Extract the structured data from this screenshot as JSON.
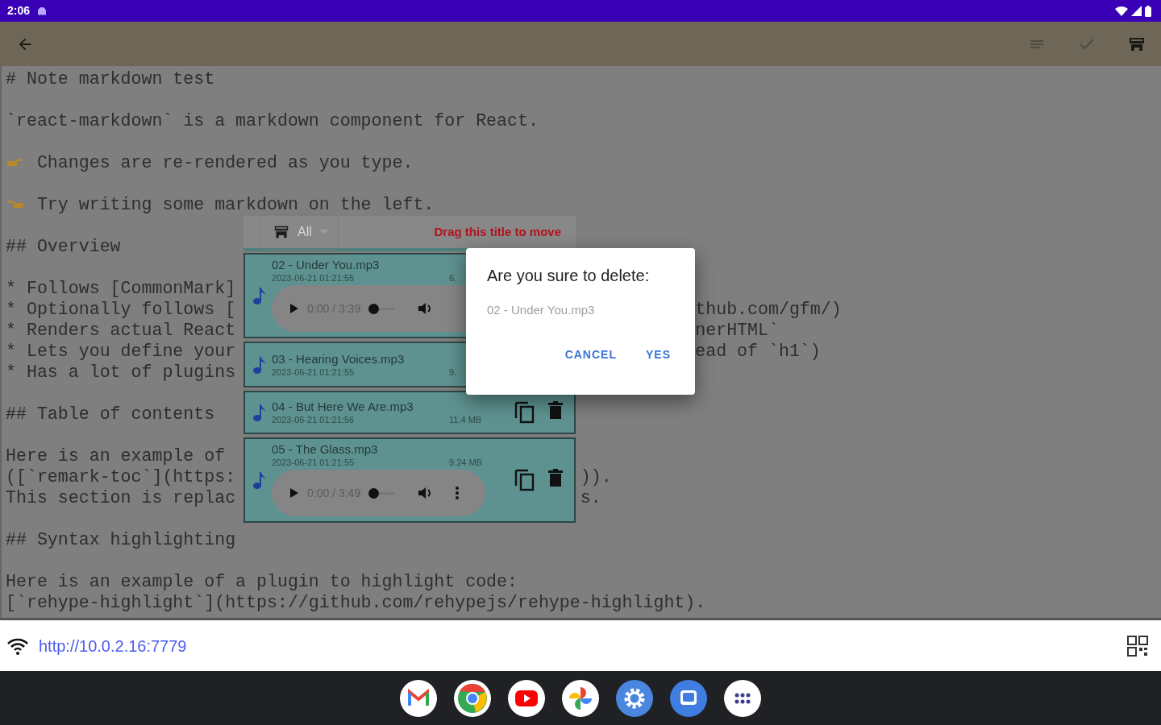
{
  "status_bar": {
    "time": "2:06"
  },
  "toolbar": {
    "actions": [
      {
        "kind": "format",
        "disabled": true
      },
      {
        "kind": "check",
        "disabled": true
      },
      {
        "kind": "save",
        "disabled": false
      }
    ]
  },
  "editor": {
    "lines": [
      {
        "kind": "text",
        "text": "# Note markdown test"
      },
      {
        "kind": "blank"
      },
      {
        "kind": "text",
        "text": "`react-markdown` is a markdown component for React."
      },
      {
        "kind": "blank"
      },
      {
        "kind": "hand-right",
        "text": "Changes are re-rendered as you type."
      },
      {
        "kind": "blank"
      },
      {
        "kind": "hand-left",
        "text": "Try writing some markdown on the left."
      },
      {
        "kind": "blank"
      },
      {
        "kind": "text",
        "text": "## Overview"
      },
      {
        "kind": "blank"
      },
      {
        "kind": "text",
        "text": "* Follows [CommonMark]"
      },
      {
        "kind": "text",
        "text": "* Optionally follows [",
        "right": "thub.com/gfm/)"
      },
      {
        "kind": "text",
        "text": "* Renders actual React",
        "right": "nerHTML`"
      },
      {
        "kind": "text",
        "text": "* Lets you define your",
        "right": "ead of `h1`)"
      },
      {
        "kind": "text",
        "text": "* Has a lot of plugins"
      },
      {
        "kind": "blank"
      },
      {
        "kind": "text",
        "text": "## Table of contents"
      },
      {
        "kind": "blank"
      },
      {
        "kind": "text",
        "text": "Here is an example of"
      },
      {
        "kind": "text",
        "text": "([`remark-toc`](https:",
        "right": "))."
      },
      {
        "kind": "text",
        "text": "This section is replac",
        "right": "s."
      },
      {
        "kind": "blank"
      },
      {
        "kind": "text",
        "text": "## Syntax highlighting"
      },
      {
        "kind": "blank"
      },
      {
        "kind": "text",
        "text": "Here is an example of a plugin to highlight code:"
      },
      {
        "kind": "text",
        "text": "[`rehype-highlight`](https://github.com/rehypejs/rehype-highlight)."
      }
    ]
  },
  "file_panel": {
    "filter": "All",
    "title": "Drag this title to move",
    "files": [
      {
        "name": "02 - Under You.mp3",
        "date": "2023-06-21 01:21:55",
        "size": "6.",
        "player": {
          "time": "0:00 / 3:39",
          "level": 0
        }
      },
      {
        "name": "03 - Hearing Voices.mp3",
        "date": "2023-06-21 01:21:55",
        "size": "9."
      },
      {
        "name": "04 - But Here We Are.mp3",
        "date": "2023-06-21 01:21:56",
        "size": "11.4 MB",
        "actions": true
      },
      {
        "name": "05 - The Glass.mp3",
        "date": "2023-06-21 01:21:55",
        "size": "9.24 MB",
        "player": {
          "time": "0:00 / 3:49",
          "level": 0,
          "menu": true
        },
        "actions": true
      }
    ]
  },
  "dialog": {
    "title": "Are you sure to delete:",
    "message": "02 - Under You.mp3",
    "buttons": [
      "CANCEL",
      "YES"
    ]
  },
  "server_bar": {
    "url": "http://10.0.2.16:7779"
  },
  "dock": {
    "apps": [
      {
        "kind": "mail"
      },
      {
        "kind": "browser"
      },
      {
        "kind": "video"
      },
      {
        "kind": "pinwheel"
      },
      {
        "kind": "settings"
      },
      {
        "kind": "chat"
      },
      {
        "kind": "apps"
      }
    ]
  }
}
